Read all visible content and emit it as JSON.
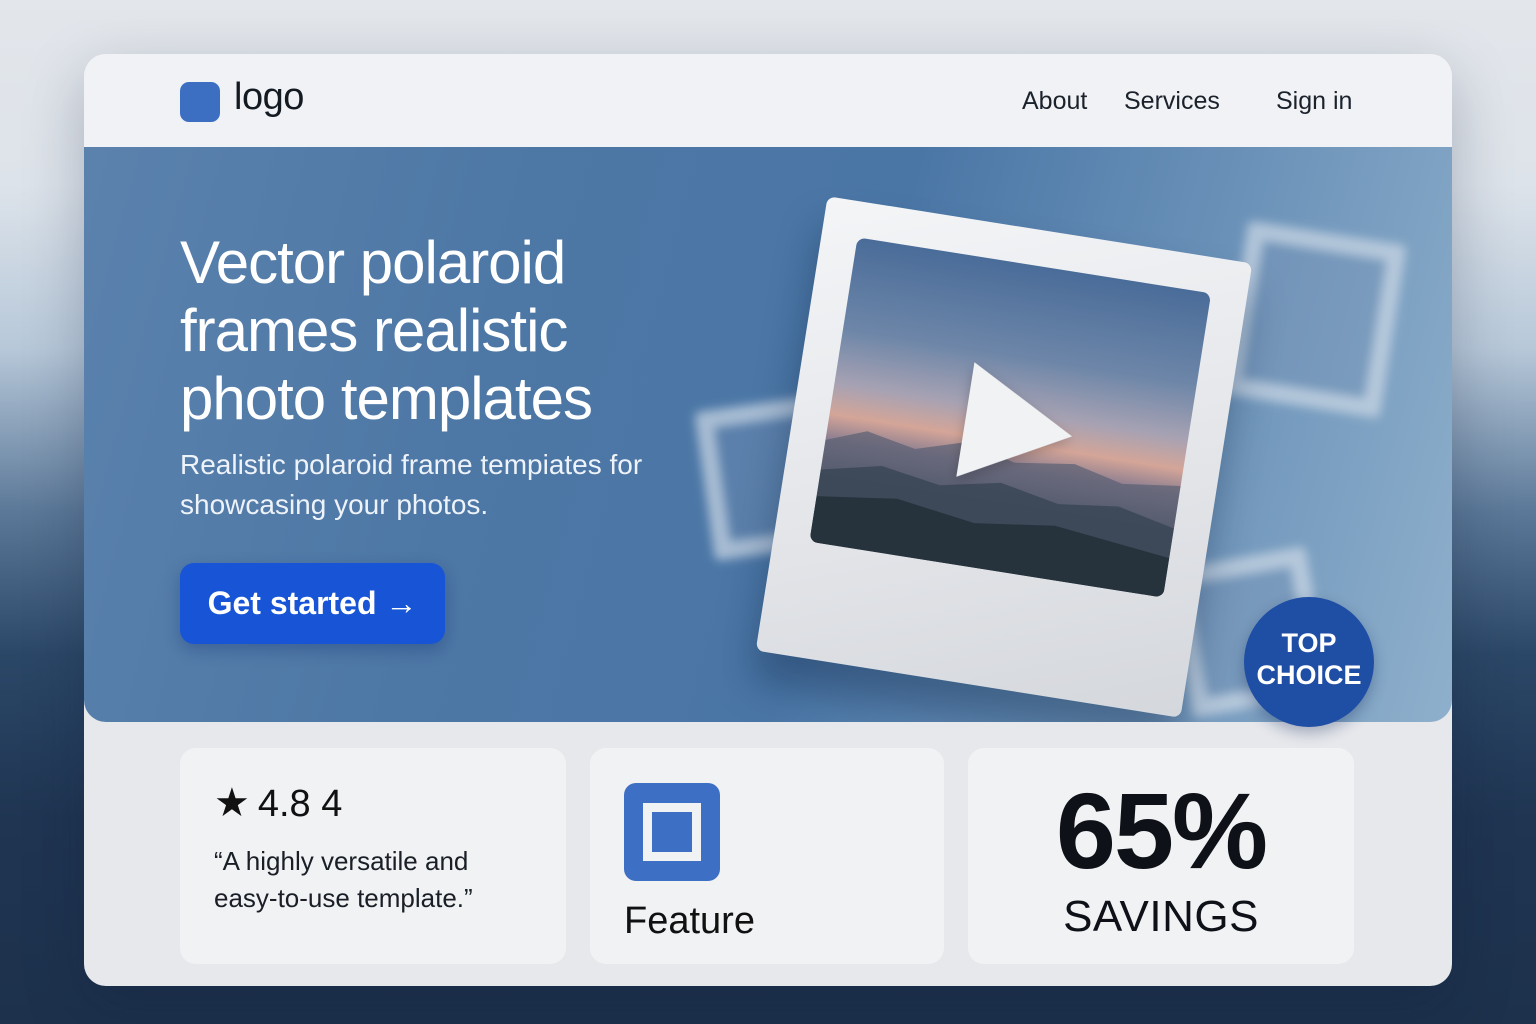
{
  "header": {
    "logo_text": "logo",
    "nav": [
      "About",
      "Services",
      "Sign in"
    ]
  },
  "hero": {
    "title": "Vector polaroid frames realistic photo templates",
    "subtitle": "Realistic polaroid frame tempiates for showcasing your photos.",
    "cta_label": "Get started →",
    "badge_line1": "TOP",
    "badge_line2": "CHOICE"
  },
  "tiles": {
    "rating_star": "★",
    "rating_value": "4.8 4",
    "quote": "“A highly versatile and easy-to-use template.”",
    "feature_label": "Feature",
    "stat_value": "65%",
    "stat_label": "SAVINGS"
  },
  "icons": {
    "logo": "logo-square-icon",
    "play": "play-icon",
    "feature": "frame-square-icon",
    "star": "star-icon"
  },
  "colors": {
    "accent": "#1755d6",
    "logo_blue": "#3c6fc2",
    "badge": "#1f4ea5",
    "hero_blue": "#4d77a5"
  }
}
